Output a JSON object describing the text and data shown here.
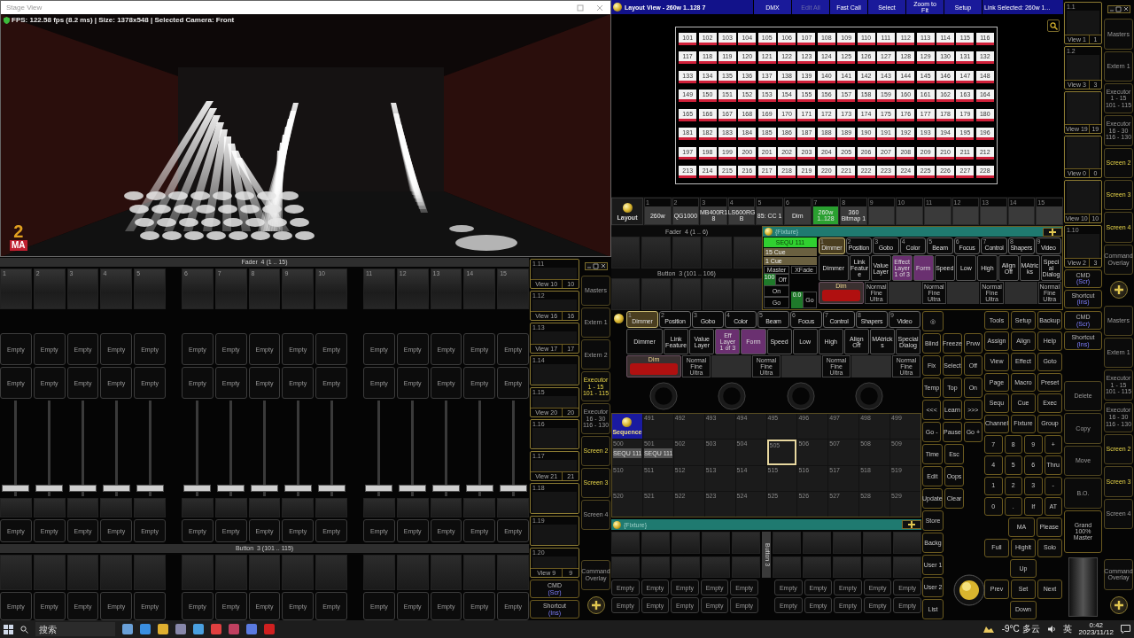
{
  "stage_view": {
    "title": "Stage View",
    "status": "FPS: 122.58 fps (8.2 ms) | Size: 1378x548 | Selected Camera: Front",
    "logo": {
      "number": "2",
      "letters": "MA"
    }
  },
  "fader_bank": {
    "title": "Fader  4 (1 .. 15)",
    "faders": [
      {
        "number": "1",
        "level": 0.05
      },
      {
        "number": "2",
        "level": 0.05
      },
      {
        "number": "3",
        "level": 0.05
      },
      {
        "number": "4",
        "level": 0.05
      },
      {
        "number": "5",
        "level": 0.05
      },
      {
        "number": "6",
        "level": 0.05
      },
      {
        "number": "7",
        "level": 0.05
      },
      {
        "number": "8",
        "level": 0.05
      },
      {
        "number": "9",
        "level": 0.05
      },
      {
        "number": "10",
        "level": 0.05
      },
      {
        "number": "11",
        "level": 0.05
      },
      {
        "number": "12",
        "level": 0.05
      },
      {
        "number": "13",
        "level": 0.05
      },
      {
        "number": "14",
        "level": 0.05
      },
      {
        "number": "15",
        "level": 0.05
      }
    ]
  },
  "button_bank": {
    "title": "Button  3 (101 .. 115)"
  },
  "executor_rows": [
    [
      "Empty",
      "Empty",
      "Empty",
      "Empty",
      "Empty",
      "Empty",
      "Empty",
      "Empty",
      "Empty",
      "Empty",
      "Empty",
      "Empty",
      "Empty",
      "Empty",
      "Empty"
    ],
    [
      "Empty",
      "Empty",
      "Empty",
      "Empty",
      "Empty",
      "Empty",
      "Empty",
      "Empty",
      "Empty",
      "Empty",
      "Empty",
      "Empty",
      "Empty",
      "Empty",
      "Empty"
    ],
    [
      "Empty",
      "Empty",
      "Empty",
      "Empty",
      "Empty",
      "Empty",
      "Empty",
      "Empty",
      "Empty",
      "Empty",
      "Empty",
      "Empty",
      "Empty",
      "Empty",
      "Empty"
    ],
    [
      "Empty",
      "Empty",
      "Empty",
      "Empty",
      "Empty",
      "Empty",
      "Empty",
      "Empty",
      "Empty",
      "Empty",
      "Empty",
      "Empty",
      "Empty",
      "Empty",
      "Empty"
    ]
  ],
  "view_column": [
    {
      "title": "1.11",
      "label": "View 10",
      "num": "10"
    },
    {
      "title": "1.12",
      "label": "View 16",
      "num": "16"
    },
    {
      "title": "1.13",
      "label": "View 17",
      "num": "17"
    },
    {
      "title": "1.14"
    },
    {
      "title": "1.15",
      "label": "View 20",
      "num": "20"
    },
    {
      "title": "1.16"
    },
    {
      "title": "1.17",
      "label": "View 21",
      "num": "21"
    },
    {
      "title": "1.18"
    },
    {
      "title": "1.19"
    },
    {
      "title": "1.20",
      "label": "View 9",
      "num": "9"
    }
  ],
  "view_column_keys": [
    {
      "label": "CMD",
      "sub": "(Scr)"
    },
    {
      "label": "Shortcut",
      "sub": "(Ins)"
    }
  ],
  "screen_column": [
    {
      "kind": "window"
    },
    {
      "kind": "screen",
      "label": "Masters",
      "active": false
    },
    {
      "kind": "screen",
      "label": "Extern 1",
      "active": false
    },
    {
      "kind": "screen",
      "label": "Extern 2",
      "active": false
    },
    {
      "kind": "screen",
      "label": "Executor\n1 - 15\n101 - 115",
      "active": true
    },
    {
      "kind": "screen",
      "label": "Executor\n16 - 30\n116 - 130",
      "active": false
    },
    {
      "kind": "screen",
      "label": "Screen 2",
      "active": true
    },
    {
      "kind": "screen",
      "label": "Screen 3",
      "active": true
    },
    {
      "kind": "screen",
      "label": "Screen 4",
      "active": false
    },
    {
      "kind": "blank"
    },
    {
      "kind": "screen",
      "label": "Command\nOverlay",
      "active": false
    },
    {
      "kind": "add"
    }
  ],
  "layout_view": {
    "title": "Layout View - 260w 1..128 7",
    "toolbar": [
      {
        "label": "DMX",
        "disabled": false
      },
      {
        "label": "Edit All",
        "disabled": true
      },
      {
        "label": "Fast Call",
        "disabled": false
      },
      {
        "label": "Select",
        "disabled": false
      },
      {
        "label": "Zoom to\nFit",
        "disabled": false
      },
      {
        "label": "Setup",
        "disabled": false
      }
    ],
    "link": "Link Selected: 260w 1...",
    "fixtures": [
      "101",
      "102",
      "103",
      "104",
      "105",
      "106",
      "107",
      "108",
      "109",
      "110",
      "111",
      "112",
      "113",
      "114",
      "115",
      "116",
      "117",
      "118",
      "119",
      "120",
      "121",
      "122",
      "123",
      "124",
      "125",
      "126",
      "127",
      "128",
      "129",
      "130",
      "131",
      "132",
      "133",
      "134",
      "135",
      "136",
      "137",
      "138",
      "139",
      "140",
      "141",
      "142",
      "143",
      "144",
      "145",
      "146",
      "147",
      "148",
      "149",
      "150",
      "151",
      "152",
      "153",
      "154",
      "155",
      "156",
      "157",
      "158",
      "159",
      "160",
      "161",
      "162",
      "163",
      "164",
      "165",
      "166",
      "167",
      "168",
      "169",
      "170",
      "171",
      "172",
      "173",
      "174",
      "175",
      "176",
      "177",
      "178",
      "179",
      "180",
      "181",
      "182",
      "183",
      "184",
      "185",
      "186",
      "187",
      "188",
      "189",
      "190",
      "191",
      "192",
      "193",
      "194",
      "195",
      "196",
      "197",
      "198",
      "199",
      "200",
      "201",
      "202",
      "203",
      "204",
      "205",
      "206",
      "207",
      "208",
      "209",
      "210",
      "211",
      "212",
      "213",
      "214",
      "215",
      "216",
      "217",
      "218",
      "219",
      "220",
      "221",
      "222",
      "223",
      "224",
      "225",
      "226",
      "227",
      "228"
    ]
  },
  "right_views": [
    {
      "title": "1.1",
      "label": "View 1",
      "num": "1"
    },
    {
      "title": "1.2",
      "label": "View 3",
      "num": "3"
    },
    {
      "label": "View 19",
      "num": "19"
    },
    {
      "label": "View 0",
      "num": "0"
    },
    {
      "label": "View 10",
      "num": "10"
    },
    {
      "title": "1.10",
      "label": "View 2",
      "num": "3"
    }
  ],
  "right_view_keys": [
    {
      "label": "CMD",
      "sub": "(Scr)"
    },
    {
      "label": "Shortcut",
      "sub": "(Ins)"
    }
  ],
  "executor_bar": {
    "label": "Layout",
    "items": [
      {
        "number": "1",
        "label": "260w",
        "selected": false
      },
      {
        "number": "2",
        "label": "QG1000",
        "selected": false
      },
      {
        "number": "3",
        "label": "MB400R1\n8",
        "selected": false
      },
      {
        "number": "4",
        "label": "LS600RG\nB",
        "selected": false
      },
      {
        "number": "5",
        "label": "85: CC 1",
        "selected": false
      },
      {
        "number": "6",
        "label": "Dim",
        "selected": false
      },
      {
        "number": "7",
        "label": "260w\n1..128",
        "selected": true
      },
      {
        "number": "8",
        "label": "360\nBitmap 1",
        "selected": false
      },
      {
        "number": "9",
        "selected": false
      },
      {
        "number": "10",
        "selected": false
      },
      {
        "number": "11",
        "selected": false
      },
      {
        "number": "12",
        "selected": false
      },
      {
        "number": "13",
        "selected": false
      },
      {
        "number": "14",
        "selected": false
      },
      {
        "number": "15",
        "selected": false
      }
    ]
  },
  "fader_mini": {
    "fader_title": "Fader  4 (1 .. 6)",
    "button_title": "Button  3 (101 .. 106)"
  },
  "fixture_window": {
    "title": "{Fixture}",
    "cue_box": {
      "sequence": "SEQU 111",
      "cues": [
        "15 Cue",
        "1 Cue"
      ],
      "master": "Master",
      "xfade": "XFade",
      "level_text": "100",
      "master_keys": [
        "Off",
        "On",
        "Go"
      ],
      "xfade_time": "0.0",
      "xfade_key": "Go"
    },
    "presets": {
      "tabs": [
        {
          "number": "1",
          "label": "Dimmer",
          "selected": true
        },
        {
          "number": "2",
          "label": "Position",
          "selected": false
        },
        {
          "number": "3",
          "label": "Gobo",
          "selected": false
        },
        {
          "number": "4",
          "label": "Color",
          "selected": false
        },
        {
          "number": "5",
          "label": "Beam",
          "selected": false
        },
        {
          "number": "6",
          "label": "Focus",
          "selected": false
        },
        {
          "number": "7",
          "label": "Control",
          "selected": false
        },
        {
          "number": "8",
          "label": "Shapers",
          "selected": false
        },
        {
          "number": "9",
          "label": "Video",
          "selected": false
        }
      ],
      "features": [
        {
          "label": "Dimmer",
          "kind": "wide"
        },
        {
          "label": "Link\nFeature",
          "kind": "plain"
        },
        {
          "label": "Value\nLayer",
          "kind": "plain"
        },
        {
          "label": "Effect\nLayer\n1 of 3",
          "kind": "effect"
        },
        {
          "label": "Form",
          "kind": "effect"
        },
        {
          "label": "Speed",
          "kind": "plain"
        },
        {
          "label": "Low",
          "kind": "plain"
        },
        {
          "label": "High",
          "kind": "plain"
        },
        {
          "label": "Align\nOff",
          "kind": "plain"
        },
        {
          "label": "MAtricks",
          "kind": "plain"
        },
        {
          "label": "Special\nDialog",
          "kind": "plain"
        }
      ],
      "dim": "Dim",
      "modes": [
        "Normal\nFine\nUltra",
        "Normal\nFine\nUltra",
        "Normal\nFine\nUltra",
        "Normal\nFine\nUltra"
      ]
    }
  },
  "lower_presets": {
    "tabs": [
      {
        "number": "1",
        "label": "Dimmer",
        "selected": true
      },
      {
        "number": "2",
        "label": "Position",
        "selected": false
      },
      {
        "number": "3",
        "label": "Gobo",
        "selected": false
      },
      {
        "number": "4",
        "label": "Color",
        "selected": false
      },
      {
        "number": "5",
        "label": "Beam",
        "selected": false
      },
      {
        "number": "6",
        "label": "Focus",
        "selected": false
      },
      {
        "number": "7",
        "label": "Control",
        "selected": false
      },
      {
        "number": "8",
        "label": "Shapers",
        "selected": false
      },
      {
        "number": "9",
        "label": "Video",
        "selected": false
      }
    ],
    "features": [
      {
        "label": "Dimmer",
        "kind": "wide"
      },
      {
        "label": "Link\nFeature",
        "kind": "plain"
      },
      {
        "label": "Value\nLayer",
        "kind": "plain"
      },
      {
        "label": "Eff Layer\n1 of 3",
        "kind": "effect"
      },
      {
        "label": "Form",
        "kind": "effect"
      },
      {
        "label": "Speed",
        "kind": "plain"
      },
      {
        "label": "Low",
        "kind": "plain"
      },
      {
        "label": "High",
        "kind": "plain"
      },
      {
        "label": "Align\nOff",
        "kind": "plain"
      },
      {
        "label": "MAtricks",
        "kind": "plain"
      },
      {
        "label": "Special\nDialog",
        "kind": "plain"
      }
    ],
    "dim": "Dim",
    "modes": [
      "Normal\nFine\nUltra",
      "Normal\nFine\nUltra",
      "Normal\nFine\nUltra",
      "Normal\nFine\nUltra"
    ]
  },
  "exec_grid": [
    {
      "kind": "sequence",
      "label": "Sequence",
      "selected": false
    },
    {
      "kind": "executor",
      "number": "491",
      "selected": false
    },
    {
      "kind": "executor",
      "number": "492",
      "selected": false
    },
    {
      "kind": "executor",
      "number": "493",
      "selected": false
    },
    {
      "kind": "executor",
      "number": "494",
      "selected": false
    },
    {
      "kind": "executor",
      "number": "495",
      "selected": false
    },
    {
      "kind": "executor",
      "number": "496",
      "selected": false
    },
    {
      "kind": "executor",
      "number": "497",
      "selected": false
    },
    {
      "kind": "executor",
      "number": "498",
      "selected": false
    },
    {
      "kind": "executor",
      "number": "499",
      "selected": false
    },
    {
      "kind": "executor",
      "number": "500",
      "label": "SEQU 111",
      "selected": false
    },
    {
      "kind": "executor",
      "number": "501",
      "label": "SEQU 111",
      "selected": false
    },
    {
      "kind": "executor",
      "number": "502",
      "selected": false
    },
    {
      "kind": "executor",
      "number": "503",
      "selected": false
    },
    {
      "kind": "executor",
      "number": "504",
      "selected": false
    },
    {
      "kind": "executor",
      "number": "505",
      "selected": true
    },
    {
      "kind": "executor",
      "number": "506",
      "selected": false
    },
    {
      "kind": "executor",
      "number": "507",
      "selected": false
    },
    {
      "kind": "executor",
      "number": "508",
      "selected": false
    },
    {
      "kind": "executor",
      "number": "509",
      "selected": false
    },
    {
      "kind": "executor",
      "number": "510",
      "selected": false
    },
    {
      "kind": "executor",
      "number": "511",
      "selected": false
    },
    {
      "kind": "executor",
      "number": "512",
      "selected": false
    },
    {
      "kind": "executor",
      "number": "513",
      "selected": false
    },
    {
      "kind": "executor",
      "number": "514",
      "selected": false
    },
    {
      "kind": "executor",
      "number": "515",
      "selected": false
    },
    {
      "kind": "executor",
      "number": "516",
      "selected": false
    },
    {
      "kind": "executor",
      "number": "517",
      "selected": false
    },
    {
      "kind": "executor",
      "number": "518",
      "selected": false
    },
    {
      "kind": "executor",
      "number": "519",
      "selected": false
    },
    {
      "kind": "executor",
      "number": "520",
      "selected": false
    },
    {
      "kind": "executor",
      "number": "521",
      "selected": false
    },
    {
      "kind": "executor",
      "number": "522",
      "selected": false
    },
    {
      "kind": "executor",
      "number": "523",
      "selected": false
    },
    {
      "kind": "executor",
      "number": "524",
      "selected": false
    },
    {
      "kind": "executor",
      "number": "525",
      "selected": false
    },
    {
      "kind": "executor",
      "number": "526",
      "selected": false
    },
    {
      "kind": "executor",
      "number": "527",
      "selected": false
    },
    {
      "kind": "executor",
      "number": "528",
      "selected": false
    },
    {
      "kind": "executor",
      "number": "529",
      "selected": false
    }
  ],
  "fixture_bar": {
    "title": "{Fixture}"
  },
  "button_area": {
    "title": "Button 3"
  },
  "bottom_rows": [
    [
      "Empty",
      "Empty",
      "Empty",
      "Empty",
      "Empty",
      "Empty",
      "Empty",
      "Empty",
      "Empty",
      "Empty"
    ],
    [
      "Empty",
      "Empty",
      "Empty",
      "Empty",
      "Empty",
      "Empty",
      "Empty",
      "Empty",
      "Empty",
      "Empty"
    ]
  ],
  "command_keys": [
    [
      "◎"
    ],
    [
      "Blind",
      "Freeze",
      "Prvw"
    ],
    [
      "Fix",
      "Select",
      "Off"
    ],
    [
      "Temp",
      "Top",
      "On"
    ],
    [
      "<<<",
      "Learn",
      ">>>"
    ],
    [
      "Go -",
      "Pause",
      "Go +"
    ],
    [
      "Time",
      "Esc"
    ],
    [
      "Edit",
      "Oops"
    ],
    [
      "Update",
      "Clear"
    ],
    [
      "Store"
    ],
    [
      "Backg"
    ],
    [
      "User 1"
    ],
    [
      "User 2"
    ],
    [
      "List"
    ]
  ],
  "keypad": [
    [
      "Tools",
      "Setup",
      "Backup"
    ],
    [
      "Assign",
      "Align",
      "Help"
    ],
    [
      "View",
      "Effect",
      "Goto"
    ],
    [
      "Page",
      "Macro",
      "Preset"
    ],
    [
      "Sequ",
      "Cue",
      "Exec"
    ],
    [
      "Channel",
      "Fixture",
      "Group"
    ],
    [
      "7",
      "8",
      "9",
      "+"
    ],
    [
      "4",
      "5",
      "6",
      "Thru"
    ],
    [
      "1",
      "2",
      "3",
      "-"
    ],
    [
      "0",
      ".",
      "If",
      "AT"
    ],
    [
      "MA",
      "Please"
    ],
    [
      "Full",
      "Highlt",
      "Solo"
    ],
    [
      "Up"
    ],
    [
      "Prev",
      "Set",
      "Next"
    ],
    [
      "Down"
    ]
  ],
  "side_keys": [
    {
      "kind": "small",
      "label": "CMD",
      "sub": "(Scr)"
    },
    {
      "kind": "small",
      "label": "Shortcut",
      "sub": "(Ins)"
    },
    {
      "kind": "blank"
    },
    {
      "kind": "key",
      "label": "Delete"
    },
    {
      "kind": "key",
      "label": "Copy"
    },
    {
      "kind": "key",
      "label": "Move"
    },
    {
      "kind": "key",
      "label": "B.O."
    },
    {
      "kind": "grand",
      "label": "Grand",
      "value": "100%",
      "sub": "Master"
    },
    {
      "kind": "fader"
    }
  ],
  "right_screen_column": [
    {
      "kind": "window"
    },
    {
      "kind": "screen",
      "label": "Masters",
      "active": false
    },
    {
      "kind": "screen",
      "label": "Extern 1",
      "active": false
    },
    {
      "kind": "screen",
      "label": "Executor\n1 - 15\n101 - 115",
      "active": false
    },
    {
      "kind": "screen",
      "label": "Executor\n16 - 30\n116 - 130",
      "active": false
    },
    {
      "kind": "screen",
      "label": "Screen 2",
      "active": true
    },
    {
      "kind": "screen",
      "label": "Screen 3",
      "active": true
    },
    {
      "kind": "screen",
      "label": "Screen 4",
      "active": true
    },
    {
      "kind": "screen",
      "label": "Command\nOverlay",
      "active": false
    },
    {
      "kind": "add"
    },
    {
      "kind": "screen",
      "label": "Masters",
      "active": false
    },
    {
      "kind": "screen",
      "label": "Extern 1",
      "active": false
    },
    {
      "kind": "screen",
      "label": "Executor\n1 - 15\n101 - 115",
      "active": false
    },
    {
      "kind": "screen",
      "label": "Executor\n16 - 30\n116 - 130",
      "active": false
    },
    {
      "kind": "screen",
      "label": "Screen 2",
      "active": true
    },
    {
      "kind": "screen",
      "label": "Screen 3",
      "active": true
    },
    {
      "kind": "screen",
      "label": "Screen 4",
      "active": false
    },
    {
      "kind": "blank"
    },
    {
      "kind": "screen",
      "label": "Command\nOverlay",
      "active": false
    },
    {
      "kind": "add"
    }
  ],
  "taskbar": {
    "placeholder": "搜索",
    "weather": "-9°C 多云",
    "ime": "英",
    "time": "0:42",
    "date": "2023/11/12"
  }
}
